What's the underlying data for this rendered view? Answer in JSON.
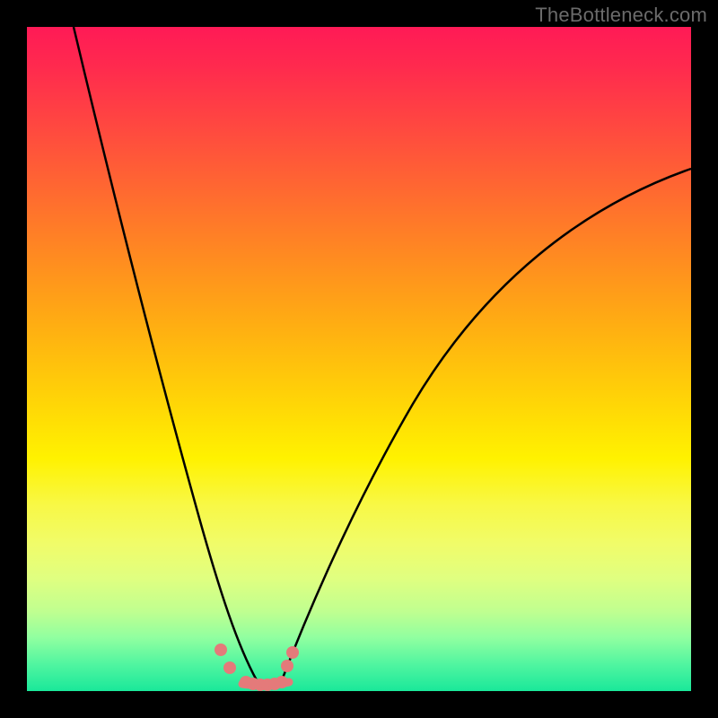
{
  "watermark": "TheBottleneck.com",
  "chart_data": {
    "type": "line",
    "title": "",
    "xlabel": "",
    "ylabel": "",
    "xlim": [
      0,
      100
    ],
    "ylim": [
      0,
      100
    ],
    "background_gradient": {
      "top": "#ff1a56",
      "bottom": "#1ae89a",
      "stops": [
        "#ff1a56",
        "#ff4840",
        "#ff8c20",
        "#ffd008",
        "#fff200",
        "#c0ff90",
        "#1ae89a"
      ]
    },
    "series": [
      {
        "name": "left-curve",
        "x": [
          7,
          11,
          15,
          19,
          23,
          26,
          29,
          31,
          33,
          35
        ],
        "y": [
          100,
          82,
          63,
          44,
          27,
          15,
          8,
          4,
          2,
          1
        ]
      },
      {
        "name": "right-curve",
        "x": [
          38,
          40,
          43,
          47,
          53,
          60,
          68,
          77,
          86,
          95,
          100
        ],
        "y": [
          1,
          3,
          8,
          17,
          30,
          44,
          56,
          65,
          72,
          77,
          79
        ]
      },
      {
        "name": "valley-markers",
        "marker_color": "#e47a7a",
        "x": [
          29,
          30.5,
          33,
          34,
          35,
          36,
          37,
          38,
          39,
          40
        ],
        "y": [
          6.5,
          3.5,
          1.2,
          1.0,
          1.0,
          1.0,
          1.0,
          1.2,
          4.0,
          6.0
        ]
      }
    ],
    "annotations": []
  }
}
